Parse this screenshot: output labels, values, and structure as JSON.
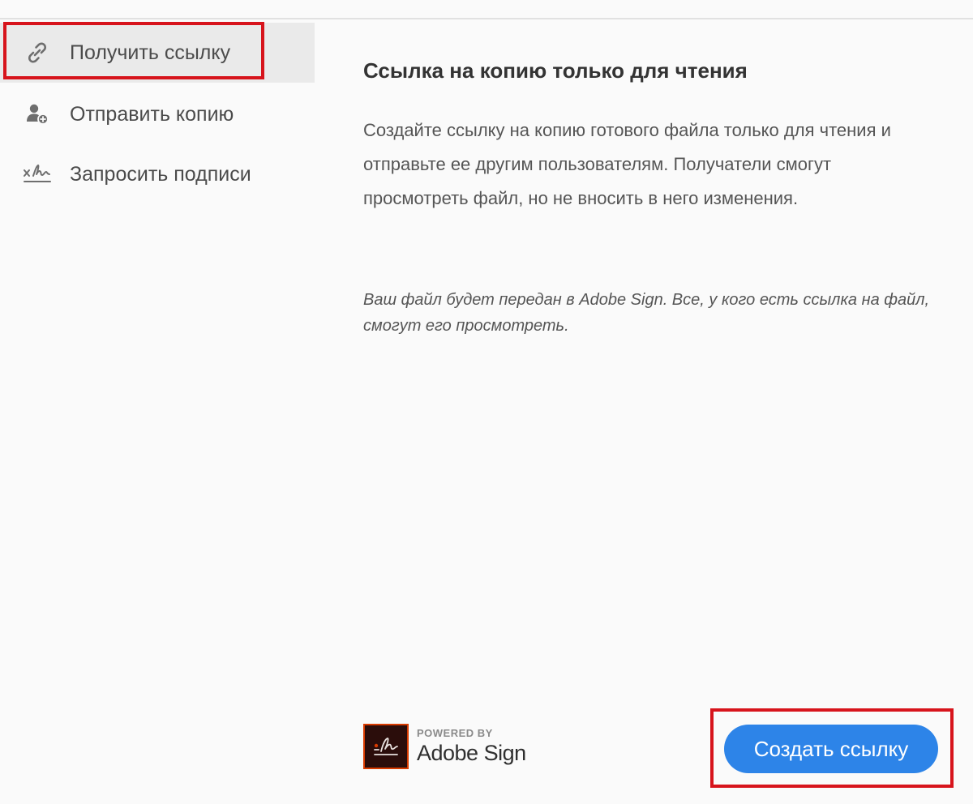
{
  "sidebar": {
    "items": [
      {
        "label": "Получить ссылку",
        "icon": "link-icon",
        "active": true
      },
      {
        "label": "Отправить копию",
        "icon": "add-user-icon",
        "active": false
      },
      {
        "label": "Запросить подписи",
        "icon": "signature-icon",
        "active": false
      }
    ]
  },
  "main": {
    "title": "Ссылка на копию только для чтения",
    "description": "Создайте ссылку на копию готового файла только для чтения и отправьте ее другим пользователям. Получатели смогут просмотреть файл, но не вносить в него изменения.",
    "note": "Ваш файл будет передан в Adobe Sign. Все, у кого есть ссылка на файл, смогут его просмотреть."
  },
  "footer": {
    "powered_by": "POWERED BY",
    "brand": "Adobe Sign",
    "create_button_label": "Создать ссылку"
  },
  "colors": {
    "accent": "#2d84e8",
    "highlight": "#d7141c",
    "active_item_bg": "#eaeaea"
  }
}
